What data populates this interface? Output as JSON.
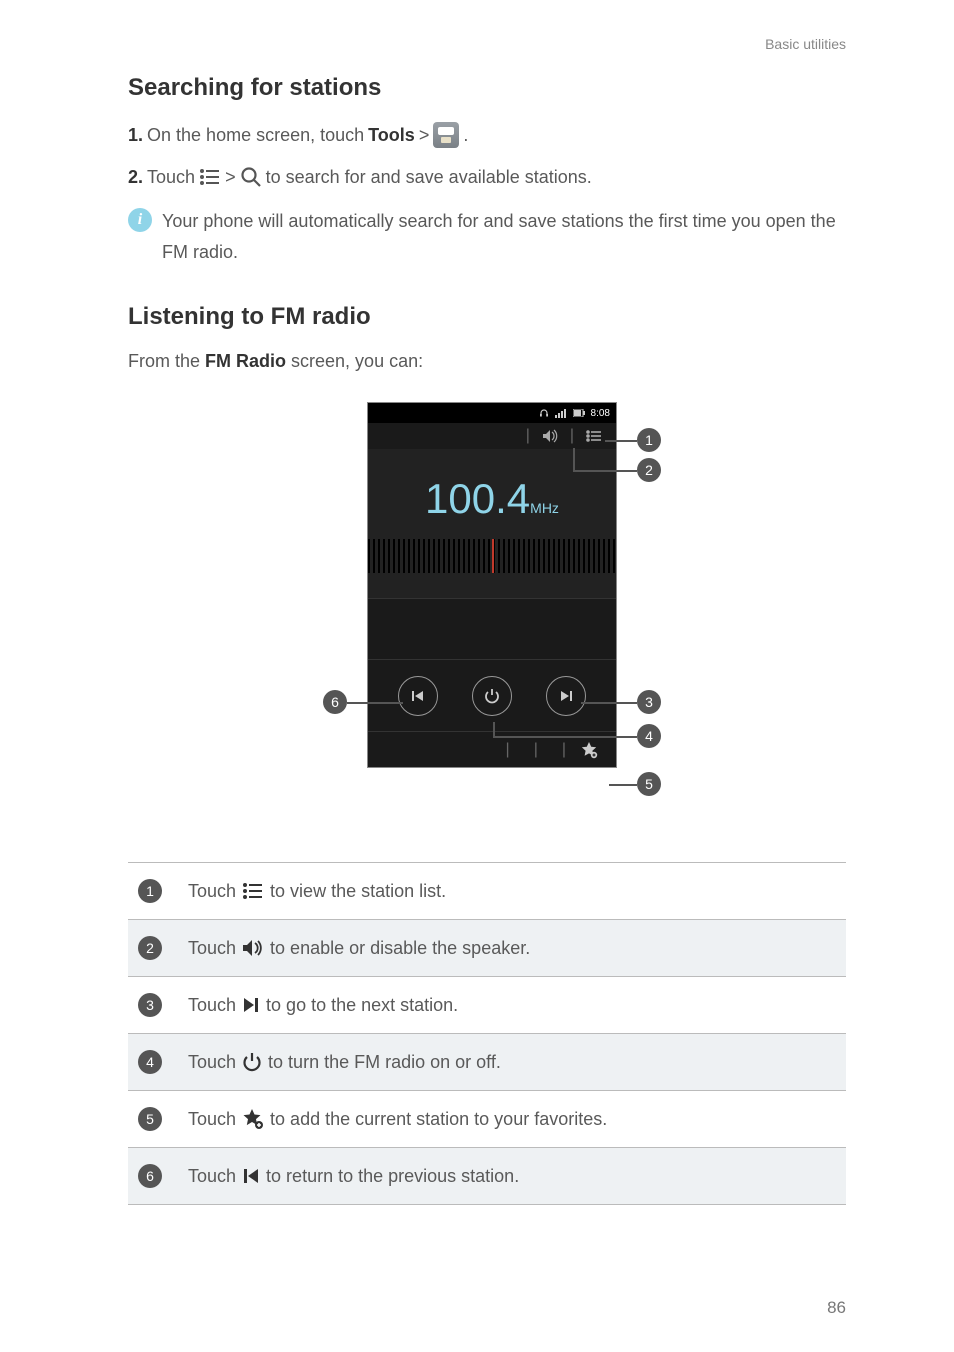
{
  "header": {
    "section": "Basic utilities"
  },
  "section1": {
    "title": "Searching for stations",
    "step1_prefix": "1.",
    "step1_text_a": "On the home screen, touch ",
    "step1_tools": "Tools",
    "step1_text_b": " > ",
    "step1_end": ".",
    "step2_prefix": "2.",
    "step2_text_a": "Touch ",
    "step2_text_b": " > ",
    "step2_text_c": " to search for and save available stations.",
    "info": "Your phone will automatically search for and save stations the first time you open the FM radio."
  },
  "section2": {
    "title": "Listening to FM radio",
    "intro_a": "From the ",
    "intro_b": "FM Radio",
    "intro_c": " screen, you can:"
  },
  "phone": {
    "time": "8:08",
    "freq_value": "100.4",
    "freq_unit": "MHz"
  },
  "callouts": {
    "c1": "1",
    "c2": "2",
    "c3": "3",
    "c4": "4",
    "c5": "5",
    "c6": "6"
  },
  "legend": [
    {
      "n": "1",
      "pre": "Touch ",
      "post": " to view the station list.",
      "icon": "list"
    },
    {
      "n": "2",
      "pre": "Touch ",
      "post": " to enable or disable the speaker.",
      "icon": "speaker"
    },
    {
      "n": "3",
      "pre": "Touch ",
      "post": " to go to the next station.",
      "icon": "next"
    },
    {
      "n": "4",
      "pre": "Touch ",
      "post": " to turn the FM radio on or off.",
      "icon": "power"
    },
    {
      "n": "5",
      "pre": "Touch ",
      "post": " to add the current station to your favorites.",
      "icon": "star-add"
    },
    {
      "n": "6",
      "pre": "Touch ",
      "post": " to return to the previous station.",
      "icon": "prev"
    }
  ],
  "page": "86"
}
